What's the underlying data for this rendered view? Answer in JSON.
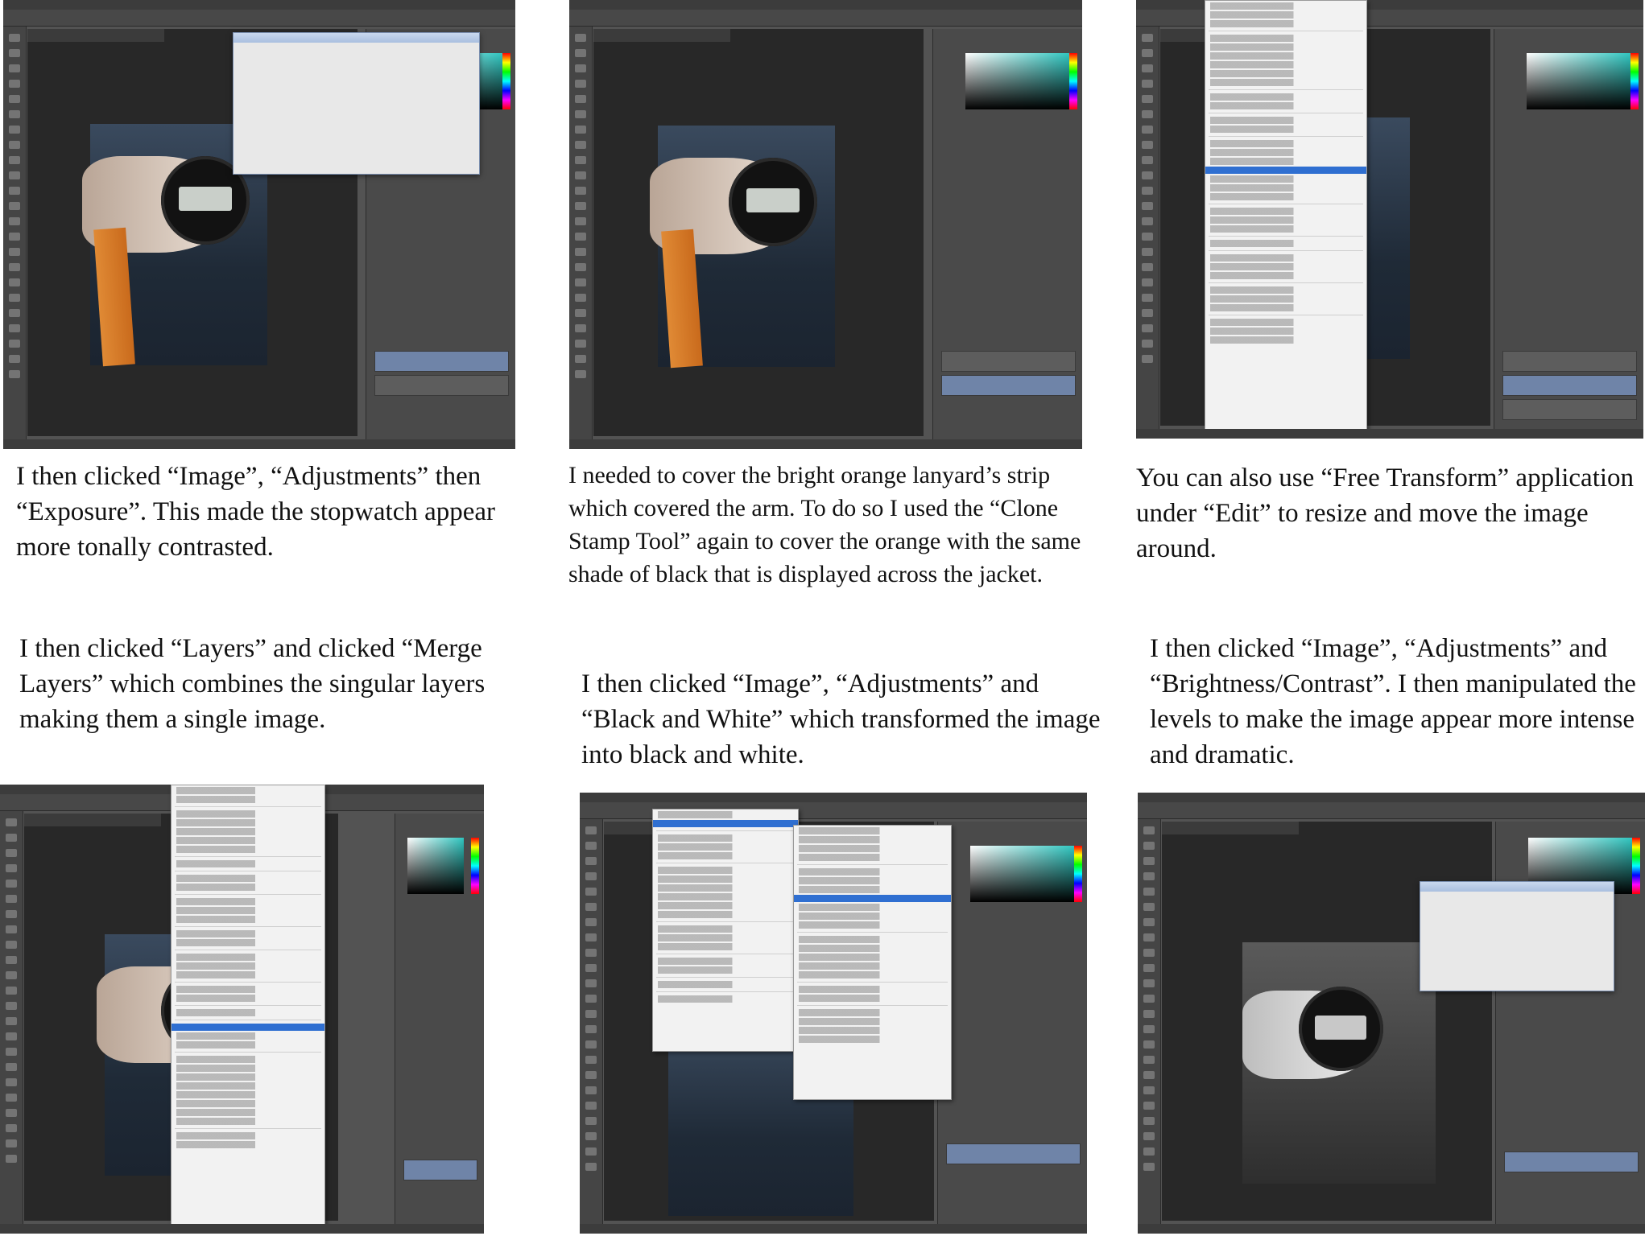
{
  "captions": {
    "exposure": "I then clicked “Image”, “Adjustments” then  “Exposure”. This made the stopwatch appear more tonally contrasted.",
    "clone_stamp": "I needed to cover the bright orange lanyard’s strip which covered the arm. To do so I used the “Clone Stamp Tool” again to cover the orange with the same shade of black that is displayed across the jacket.",
    "free_transform": "You can also use “Free Transform” application under “Edit” to resize and move the image around.",
    "merge_layers": "I then clicked “Layers” and clicked “Merge Layers” which combines the singular layers making them a single image.",
    "black_white": "I then clicked “Image”, “Adjustments” and “Black and White” which transformed the image into black and white.",
    "brightness_contrast": "I then clicked “Image”, “Adjustments” and “Brightness/Contrast”. I then manipulated the levels to make the image appear more intense and dramatic."
  },
  "screenshots": [
    {
      "id": "exposure",
      "description": "Photoshop with Exposure dialog open"
    },
    {
      "id": "clone_stamp",
      "description": "Photoshop with Clone Stamp tool result"
    },
    {
      "id": "free_transform",
      "description": "Photoshop with Edit menu open, Free Transform highlighted"
    },
    {
      "id": "merge_layers",
      "description": "Photoshop with Layers menu open"
    },
    {
      "id": "black_white",
      "description": "Photoshop with Image > Adjustments submenu, Black & White highlighted"
    },
    {
      "id": "brightness_contrast",
      "description": "Photoshop with Brightness/Contrast dialog on black and white image"
    }
  ],
  "colors": {
    "ps_dark": "#535353",
    "ps_panel": "#4a4a4a",
    "menu_highlight": "#2f6fd1",
    "lanyard_orange": "#e08a35"
  }
}
